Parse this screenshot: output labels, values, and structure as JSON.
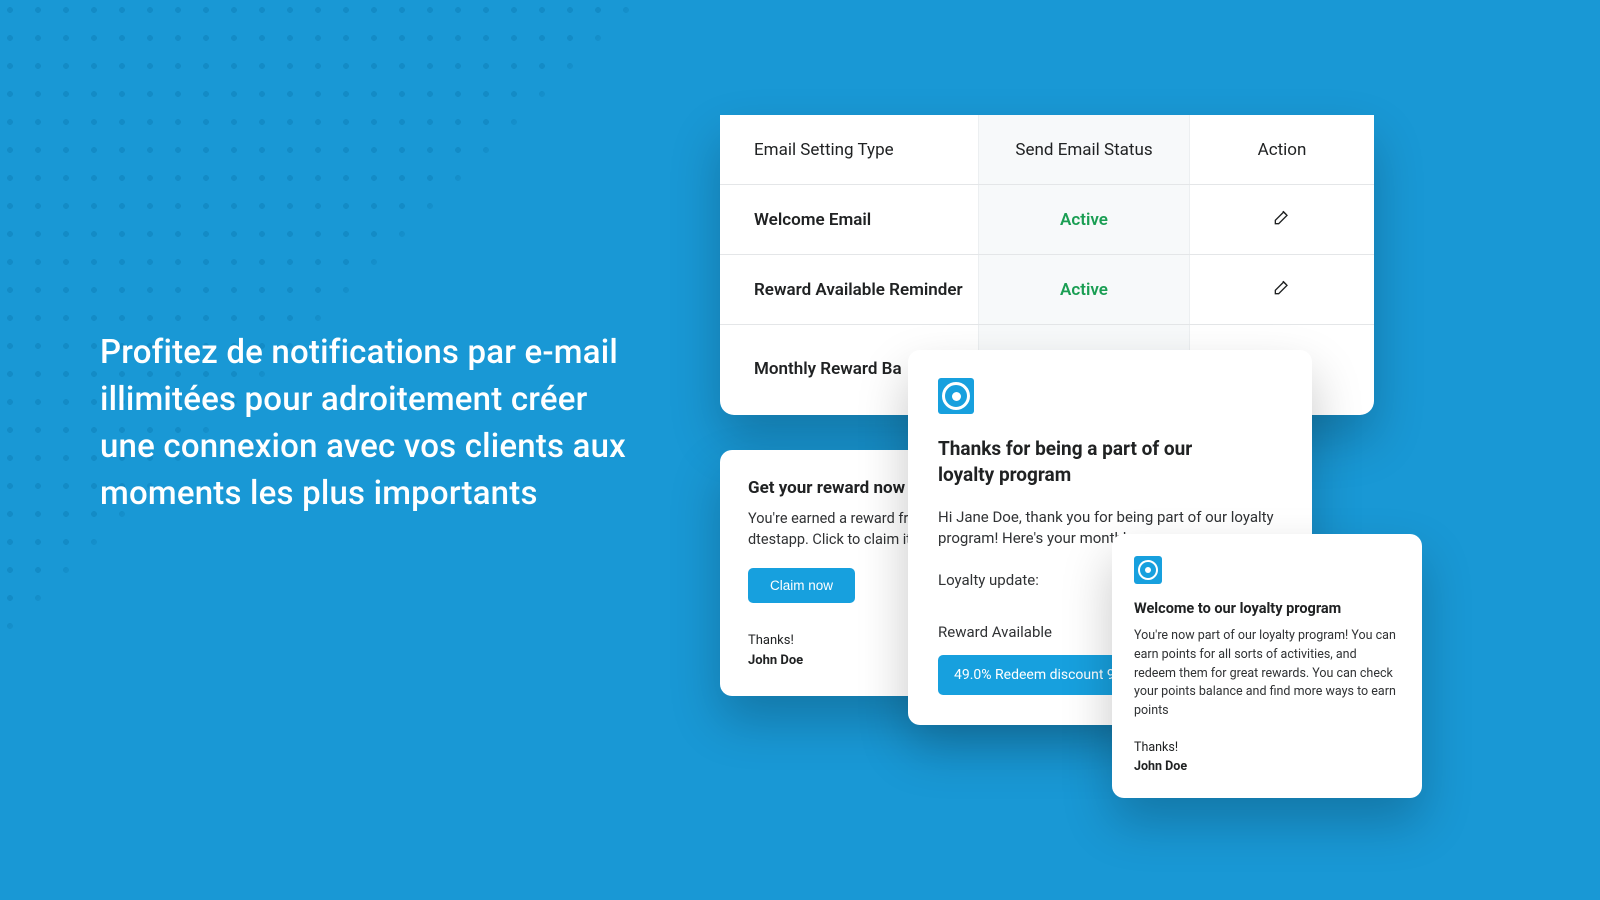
{
  "headline": "Profitez de notifications par e-mail illimitées pour adroitement créer une connexion avec vos clients aux moments les plus importants",
  "table": {
    "headers": {
      "type": "Email Setting Type",
      "status": "Send Email Status",
      "action": "Action"
    },
    "rows": [
      {
        "type": "Welcome Email",
        "status": "Active"
      },
      {
        "type": "Reward  Available Reminder",
        "status": "Active"
      },
      {
        "type": "Monthly Reward Ba",
        "status": ""
      }
    ]
  },
  "reward": {
    "title": "Get your reward now a",
    "body": "You're earned a reward from program at dtestapp. Click to claim it now!",
    "button": "Claim now",
    "thanks": "Thanks!",
    "name": "John Doe"
  },
  "loyalty": {
    "title": "Thanks for being a part of our loyalty program",
    "body": "Hi Jane Doe, thank you for being part of our loyalty program! Here's your monthly",
    "sub": "Loyalty update:",
    "section": "Reward Available",
    "banner": "49.0% Redeem discount 98 Po"
  },
  "welcome": {
    "title": "Welcome to our loyalty program",
    "body": "You're now part of our loyalty program! You can earn points for all sorts of activities, and redeem them for great rewards. You can check your points balance and find more ways to earn points",
    "thanks": "Thanks!",
    "name": "John Doe"
  }
}
